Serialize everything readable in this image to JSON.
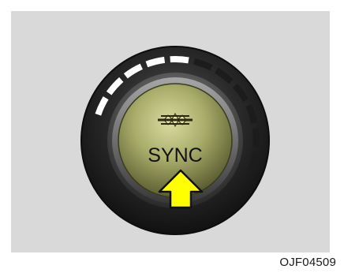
{
  "illustration": {
    "button_label": "SYNC",
    "indicator_icon": "air-flow-indicator-icon",
    "arrow_icon": "press-arrow-icon",
    "colors": {
      "background_panel": "#d9d9d9",
      "knob_outer": "#2b2b2b",
      "button_face": "#c9cc88",
      "arrow_fill": "#ffff00",
      "segments_on": "#ffffff",
      "segments_off": "#1c1c1c"
    },
    "segments": {
      "total": 11,
      "lit": 5
    }
  },
  "figure_code": "OJF04509"
}
